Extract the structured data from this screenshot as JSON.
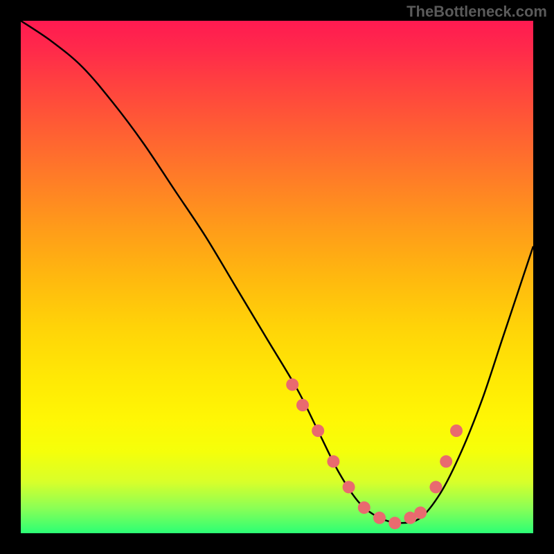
{
  "watermark": "TheBottleneck.com",
  "chart_data": {
    "type": "line",
    "title": "",
    "xlabel": "",
    "ylabel": "",
    "xlim": [
      0,
      100
    ],
    "ylim": [
      0,
      100
    ],
    "series": [
      {
        "name": "bottleneck-curve",
        "x": [
          0,
          6,
          12,
          18,
          24,
          30,
          36,
          42,
          48,
          54,
          58,
          62,
          66,
          70,
          74,
          78,
          82,
          86,
          90,
          94,
          98,
          100
        ],
        "y": [
          100,
          96,
          91,
          84,
          76,
          67,
          58,
          48,
          38,
          28,
          20,
          12,
          6,
          3,
          2,
          3,
          8,
          16,
          26,
          38,
          50,
          56
        ]
      }
    ],
    "markers": {
      "name": "highlight-points",
      "x": [
        53,
        55,
        58,
        61,
        64,
        67,
        70,
        73,
        76,
        78,
        81,
        83,
        85
      ],
      "y": [
        29,
        25,
        20,
        14,
        9,
        5,
        3,
        2,
        3,
        4,
        9,
        14,
        20
      ]
    },
    "gradient_stops": [
      {
        "pos": 0,
        "color": "#ff1a51"
      },
      {
        "pos": 50,
        "color": "#ffb80f"
      },
      {
        "pos": 80,
        "color": "#fff705"
      },
      {
        "pos": 100,
        "color": "#2bff75"
      }
    ]
  }
}
